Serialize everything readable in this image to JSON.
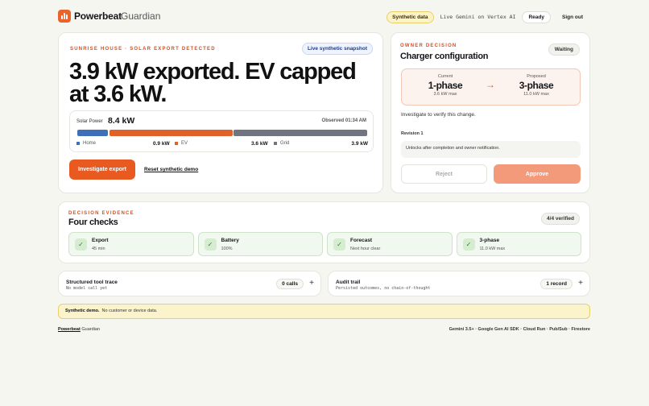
{
  "header": {
    "brand": "Powerbeat",
    "product": "Guardian",
    "synthetic_pill": "Synthetic data",
    "vertex_status": "Live Gemini on Vertex AI",
    "ready_pill": "Ready",
    "sign_out": "Sign out"
  },
  "hero": {
    "eyebrow": "SUNRISE HOUSE · SOLAR EXPORT DETECTED",
    "live_pill": "Live synthetic snapshot",
    "headline": "3.9 kW exported. EV capped at 3.6 kW.",
    "solar_label": "Solar Power",
    "solar_value": "8.4 kW",
    "observed": "Observed 01:34 AM",
    "flows": [
      {
        "label": "Home",
        "value": "0.9 kW",
        "kw": 0.9,
        "color": "#3f6fb8"
      },
      {
        "label": "EV",
        "value": "3.6 kW",
        "kw": 3.6,
        "color": "#e0622a"
      },
      {
        "label": "Grid",
        "value": "3.9 kW",
        "kw": 3.9,
        "color": "#707580"
      }
    ],
    "primary_button": "Investigate export",
    "reset_link": "Reset synthetic demo"
  },
  "decision": {
    "eyebrow": "OWNER DECISION",
    "title": "Charger configuration",
    "status_pill": "Waiting",
    "current": {
      "label": "Current",
      "value": "1-phase",
      "sub": "3.6 kW max"
    },
    "proposed": {
      "label": "Proposed",
      "value": "3-phase",
      "sub": "11.0 kW max"
    },
    "verify_text": "Investigate to verify this change.",
    "revision_label": "Revision 1",
    "revision_note": "Unlocks after completion and owner notification.",
    "reject_label": "Reject",
    "approve_label": "Approve"
  },
  "evidence": {
    "eyebrow": "DECISION EVIDENCE",
    "title": "Four checks",
    "verified_pill": "4/4 verified",
    "checks": [
      {
        "title": "Export",
        "sub": "45 min"
      },
      {
        "title": "Battery",
        "sub": "100%"
      },
      {
        "title": "Forecast",
        "sub": "Next hour clear"
      },
      {
        "title": "3-phase",
        "sub": "11.0 kW max"
      }
    ]
  },
  "trace": {
    "title": "Structured tool trace",
    "sub": "No model call yet",
    "count": "0 calls"
  },
  "audit": {
    "title": "Audit trail",
    "sub": "Persisted outcomes, no chain-of-thought",
    "count": "1 record"
  },
  "banner": {
    "strong": "Synthetic demo.",
    "text": "No customer or device data."
  },
  "footer": {
    "brand": "Powerbeat",
    "product": "Guardian",
    "stack": "Gemini 3.5+ · Google Gen AI SDK · Cloud Run · Pub/Sub · Firestore"
  },
  "colors": {
    "accent": "#e85a20",
    "home": "#3f6fb8",
    "ev": "#e0622a",
    "grid": "#707580"
  }
}
